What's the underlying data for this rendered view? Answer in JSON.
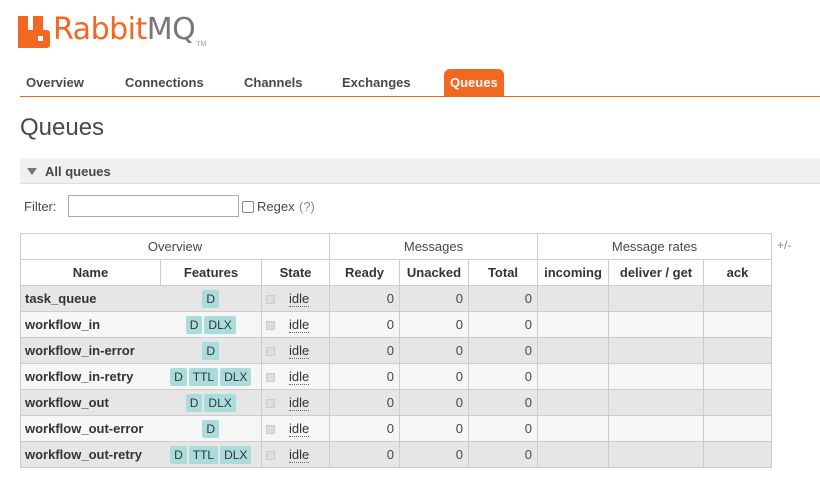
{
  "logo": {
    "brand": "Rabbit",
    "brand_suffix": "MQ",
    "tm": "TM"
  },
  "nav": {
    "tabs": [
      {
        "label": "Overview",
        "active": false
      },
      {
        "label": "Connections",
        "active": false
      },
      {
        "label": "Channels",
        "active": false
      },
      {
        "label": "Exchanges",
        "active": false
      },
      {
        "label": "Queues",
        "active": true
      }
    ],
    "accent_color": "#f26722"
  },
  "page": {
    "title": "Queues"
  },
  "section": {
    "label": "All queues",
    "expanded": true
  },
  "filter": {
    "label": "Filter:",
    "value": "",
    "placeholder": "",
    "regex_label": "Regex",
    "regex_help": "(?)",
    "regex_checked": false
  },
  "table": {
    "toggle_columns": "+/-",
    "groups": [
      "Overview",
      "Messages",
      "Message rates"
    ],
    "columns": [
      "Name",
      "Features",
      "State",
      "Ready",
      "Unacked",
      "Total",
      "incoming",
      "deliver / get",
      "ack"
    ],
    "rows": [
      {
        "name": "task_queue",
        "features": [
          "D"
        ],
        "state": "idle",
        "ready": "0",
        "unacked": "0",
        "total": "0",
        "incoming": "",
        "deliver_get": "",
        "ack": ""
      },
      {
        "name": "workflow_in",
        "features": [
          "D",
          "DLX"
        ],
        "state": "idle",
        "ready": "0",
        "unacked": "0",
        "total": "0",
        "incoming": "",
        "deliver_get": "",
        "ack": ""
      },
      {
        "name": "workflow_in-error",
        "features": [
          "D"
        ],
        "state": "idle",
        "ready": "0",
        "unacked": "0",
        "total": "0",
        "incoming": "",
        "deliver_get": "",
        "ack": ""
      },
      {
        "name": "workflow_in-retry",
        "features": [
          "D",
          "TTL",
          "DLX"
        ],
        "state": "idle",
        "ready": "0",
        "unacked": "0",
        "total": "0",
        "incoming": "",
        "deliver_get": "",
        "ack": ""
      },
      {
        "name": "workflow_out",
        "features": [
          "D",
          "DLX"
        ],
        "state": "idle",
        "ready": "0",
        "unacked": "0",
        "total": "0",
        "incoming": "",
        "deliver_get": "",
        "ack": ""
      },
      {
        "name": "workflow_out-error",
        "features": [
          "D"
        ],
        "state": "idle",
        "ready": "0",
        "unacked": "0",
        "total": "0",
        "incoming": "",
        "deliver_get": "",
        "ack": ""
      },
      {
        "name": "workflow_out-retry",
        "features": [
          "D",
          "TTL",
          "DLX"
        ],
        "state": "idle",
        "ready": "0",
        "unacked": "0",
        "total": "0",
        "incoming": "",
        "deliver_get": "",
        "ack": ""
      }
    ]
  }
}
